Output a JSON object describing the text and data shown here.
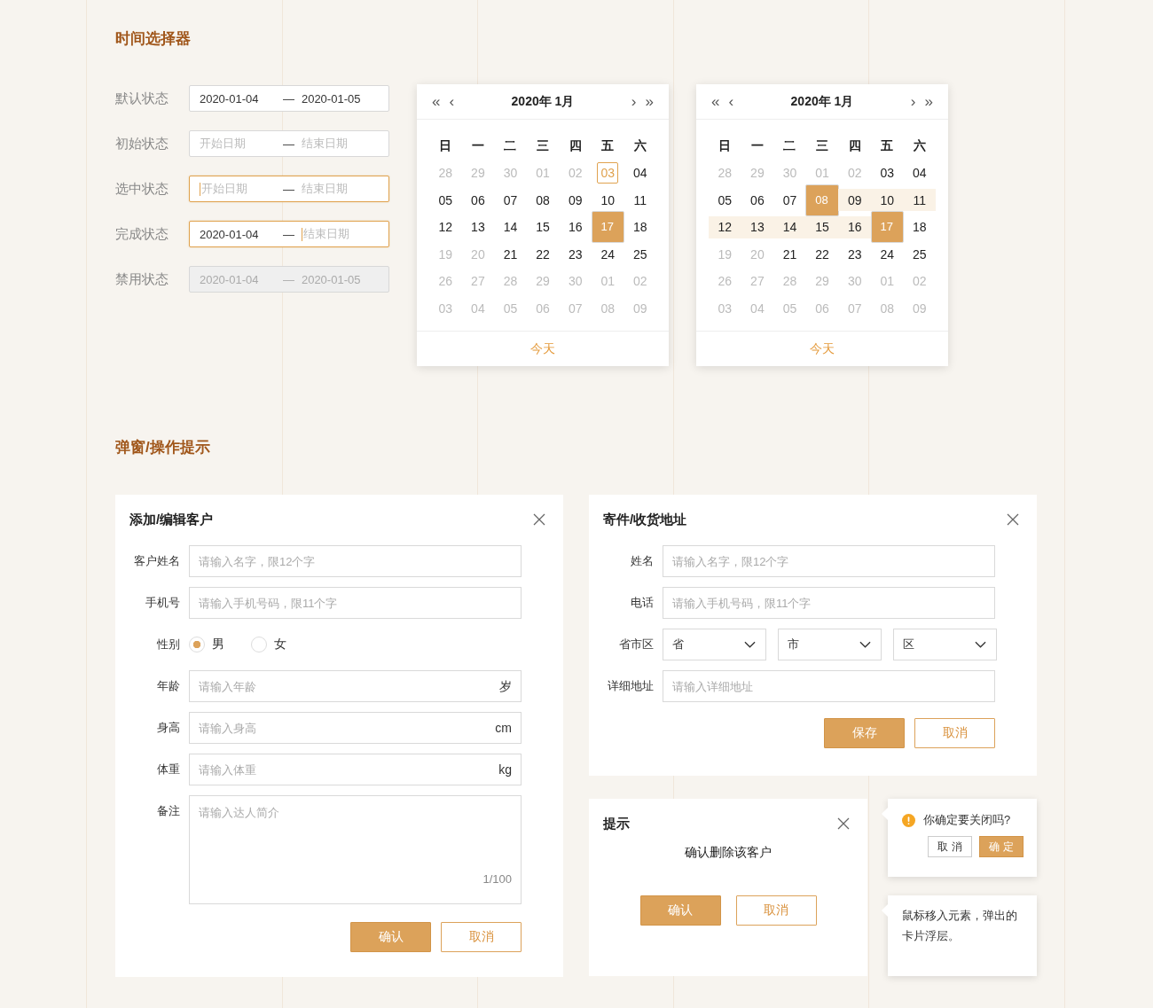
{
  "date_picker": {
    "title": "时间选择器",
    "rows": [
      {
        "label": "默认状态",
        "focused": false,
        "disabled": false,
        "separator": "—",
        "start": {
          "value": "2020-01-04",
          "cursor": false
        },
        "end": {
          "value": "2020-01-05",
          "cursor": false
        }
      },
      {
        "label": "初始状态",
        "focused": false,
        "disabled": false,
        "separator": "—",
        "start": {
          "placeholder": "开始日期",
          "cursor": false
        },
        "end": {
          "placeholder": "结束日期",
          "cursor": false
        }
      },
      {
        "label": "选中状态",
        "focused": true,
        "disabled": false,
        "separator": "—",
        "start": {
          "placeholder": "开始日期",
          "cursor": true
        },
        "end": {
          "placeholder": "结束日期",
          "cursor": false
        }
      },
      {
        "label": "完成状态",
        "focused": true,
        "disabled": false,
        "separator": "—",
        "start": {
          "value": "2020-01-04",
          "cursor": false
        },
        "end": {
          "placeholder": "结束日期",
          "cursor": true
        }
      },
      {
        "label": "禁用状态",
        "focused": false,
        "disabled": true,
        "separator": "—",
        "start": {
          "value": "2020-01-04",
          "cursor": false
        },
        "end": {
          "value": "2020-01-05",
          "cursor": false
        }
      }
    ],
    "calendars": [
      {
        "nav": [
          {
            "kind": "prev_year",
            "text": "«"
          },
          {
            "kind": "prev_month",
            "text": "‹"
          },
          {
            "kind": "title",
            "text": "2020年 1月"
          },
          {
            "kind": "next_month",
            "text": "›"
          },
          {
            "kind": "next_year",
            "text": "»"
          }
        ],
        "weekdays": [
          "日",
          "一",
          "二",
          "三",
          "四",
          "五",
          "六"
        ],
        "weeks": [
          [
            {
              "day": "28",
              "muted": true,
              "today": false,
              "selected": false,
              "in_range": false
            },
            {
              "day": "29",
              "muted": true,
              "today": false,
              "selected": false,
              "in_range": false
            },
            {
              "day": "30",
              "muted": true,
              "today": false,
              "selected": false,
              "in_range": false
            },
            {
              "day": "01",
              "muted": true,
              "today": false,
              "selected": false,
              "in_range": false
            },
            {
              "day": "02",
              "muted": true,
              "today": false,
              "selected": false,
              "in_range": false
            },
            {
              "day": "03",
              "muted": false,
              "today": true,
              "selected": false,
              "in_range": false
            },
            {
              "day": "04",
              "muted": false,
              "today": false,
              "selected": false,
              "in_range": false
            }
          ],
          [
            {
              "day": "05",
              "muted": false,
              "today": false,
              "selected": false,
              "in_range": false
            },
            {
              "day": "06",
              "muted": false,
              "today": false,
              "selected": false,
              "in_range": false
            },
            {
              "day": "07",
              "muted": false,
              "today": false,
              "selected": false,
              "in_range": false
            },
            {
              "day": "08",
              "muted": false,
              "today": false,
              "selected": false,
              "in_range": false
            },
            {
              "day": "09",
              "muted": false,
              "today": false,
              "selected": false,
              "in_range": false
            },
            {
              "day": "10",
              "muted": false,
              "today": false,
              "selected": false,
              "in_range": false
            },
            {
              "day": "11",
              "muted": false,
              "today": false,
              "selected": false,
              "in_range": false
            }
          ],
          [
            {
              "day": "12",
              "muted": false,
              "today": false,
              "selected": false,
              "in_range": false
            },
            {
              "day": "13",
              "muted": false,
              "today": false,
              "selected": false,
              "in_range": false
            },
            {
              "day": "14",
              "muted": false,
              "today": false,
              "selected": false,
              "in_range": false
            },
            {
              "day": "15",
              "muted": false,
              "today": false,
              "selected": false,
              "in_range": false
            },
            {
              "day": "16",
              "muted": false,
              "today": false,
              "selected": false,
              "in_range": false
            },
            {
              "day": "17",
              "muted": false,
              "today": false,
              "selected": true,
              "in_range": false
            },
            {
              "day": "18",
              "muted": false,
              "today": false,
              "selected": false,
              "in_range": false
            }
          ],
          [
            {
              "day": "19",
              "muted": true,
              "today": false,
              "selected": false,
              "in_range": false
            },
            {
              "day": "20",
              "muted": true,
              "today": false,
              "selected": false,
              "in_range": false
            },
            {
              "day": "21",
              "muted": false,
              "today": false,
              "selected": false,
              "in_range": false
            },
            {
              "day": "22",
              "muted": false,
              "today": false,
              "selected": false,
              "in_range": false
            },
            {
              "day": "23",
              "muted": false,
              "today": false,
              "selected": false,
              "in_range": false
            },
            {
              "day": "24",
              "muted": false,
              "today": false,
              "selected": false,
              "in_range": false
            },
            {
              "day": "25",
              "muted": false,
              "today": false,
              "selected": false,
              "in_range": false
            }
          ],
          [
            {
              "day": "26",
              "muted": true,
              "today": false,
              "selected": false,
              "in_range": false
            },
            {
              "day": "27",
              "muted": true,
              "today": false,
              "selected": false,
              "in_range": false
            },
            {
              "day": "28",
              "muted": true,
              "today": false,
              "selected": false,
              "in_range": false
            },
            {
              "day": "29",
              "muted": true,
              "today": false,
              "selected": false,
              "in_range": false
            },
            {
              "day": "30",
              "muted": true,
              "today": false,
              "selected": false,
              "in_range": false
            },
            {
              "day": "01",
              "muted": true,
              "today": false,
              "selected": false,
              "in_range": false
            },
            {
              "day": "02",
              "muted": true,
              "today": false,
              "selected": false,
              "in_range": false
            }
          ],
          [
            {
              "day": "03",
              "muted": true,
              "today": false,
              "selected": false,
              "in_range": false
            },
            {
              "day": "04",
              "muted": true,
              "today": false,
              "selected": false,
              "in_range": false
            },
            {
              "day": "05",
              "muted": true,
              "today": false,
              "selected": false,
              "in_range": false
            },
            {
              "day": "06",
              "muted": true,
              "today": false,
              "selected": false,
              "in_range": false
            },
            {
              "day": "07",
              "muted": true,
              "today": false,
              "selected": false,
              "in_range": false
            },
            {
              "day": "08",
              "muted": true,
              "today": false,
              "selected": false,
              "in_range": false
            },
            {
              "day": "09",
              "muted": true,
              "today": false,
              "selected": false,
              "in_range": false
            }
          ]
        ],
        "footer": "今天"
      },
      {
        "nav": [
          {
            "kind": "prev_year",
            "text": "«"
          },
          {
            "kind": "prev_month",
            "text": "‹"
          },
          {
            "kind": "title",
            "text": "2020年 1月"
          },
          {
            "kind": "next_month",
            "text": "›"
          },
          {
            "kind": "next_year",
            "text": "»"
          }
        ],
        "weekdays": [
          "日",
          "一",
          "二",
          "三",
          "四",
          "五",
          "六"
        ],
        "weeks": [
          [
            {
              "day": "28",
              "muted": true,
              "today": false,
              "selected": false,
              "in_range": false
            },
            {
              "day": "29",
              "muted": true,
              "today": false,
              "selected": false,
              "in_range": false
            },
            {
              "day": "30",
              "muted": true,
              "today": false,
              "selected": false,
              "in_range": false
            },
            {
              "day": "01",
              "muted": true,
              "today": false,
              "selected": false,
              "in_range": false
            },
            {
              "day": "02",
              "muted": true,
              "today": false,
              "selected": false,
              "in_range": false
            },
            {
              "day": "03",
              "muted": false,
              "today": false,
              "selected": false,
              "in_range": false
            },
            {
              "day": "04",
              "muted": false,
              "today": false,
              "selected": false,
              "in_range": false
            }
          ],
          [
            {
              "day": "05",
              "muted": false,
              "today": false,
              "selected": false,
              "in_range": false
            },
            {
              "day": "06",
              "muted": false,
              "today": false,
              "selected": false,
              "in_range": false
            },
            {
              "day": "07",
              "muted": false,
              "today": false,
              "selected": false,
              "in_range": false
            },
            {
              "day": "08",
              "muted": false,
              "today": false,
              "selected": true,
              "in_range": true
            },
            {
              "day": "09",
              "muted": false,
              "today": false,
              "selected": false,
              "in_range": true
            },
            {
              "day": "10",
              "muted": false,
              "today": false,
              "selected": false,
              "in_range": true
            },
            {
              "day": "11",
              "muted": false,
              "today": false,
              "selected": false,
              "in_range": true
            }
          ],
          [
            {
              "day": "12",
              "muted": false,
              "today": false,
              "selected": false,
              "in_range": true
            },
            {
              "day": "13",
              "muted": false,
              "today": false,
              "selected": false,
              "in_range": true
            },
            {
              "day": "14",
              "muted": false,
              "today": false,
              "selected": false,
              "in_range": true
            },
            {
              "day": "15",
              "muted": false,
              "today": false,
              "selected": false,
              "in_range": true
            },
            {
              "day": "16",
              "muted": false,
              "today": false,
              "selected": false,
              "in_range": true
            },
            {
              "day": "17",
              "muted": false,
              "today": false,
              "selected": true,
              "in_range": true
            },
            {
              "day": "18",
              "muted": false,
              "today": false,
              "selected": false,
              "in_range": false
            }
          ],
          [
            {
              "day": "19",
              "muted": true,
              "today": false,
              "selected": false,
              "in_range": false
            },
            {
              "day": "20",
              "muted": true,
              "today": false,
              "selected": false,
              "in_range": false
            },
            {
              "day": "21",
              "muted": false,
              "today": false,
              "selected": false,
              "in_range": false
            },
            {
              "day": "22",
              "muted": false,
              "today": false,
              "selected": false,
              "in_range": false
            },
            {
              "day": "23",
              "muted": false,
              "today": false,
              "selected": false,
              "in_range": false
            },
            {
              "day": "24",
              "muted": false,
              "today": false,
              "selected": false,
              "in_range": false
            },
            {
              "day": "25",
              "muted": false,
              "today": false,
              "selected": false,
              "in_range": false
            }
          ],
          [
            {
              "day": "26",
              "muted": true,
              "today": false,
              "selected": false,
              "in_range": false
            },
            {
              "day": "27",
              "muted": true,
              "today": false,
              "selected": false,
              "in_range": false
            },
            {
              "day": "28",
              "muted": true,
              "today": false,
              "selected": false,
              "in_range": false
            },
            {
              "day": "29",
              "muted": true,
              "today": false,
              "selected": false,
              "in_range": false
            },
            {
              "day": "30",
              "muted": true,
              "today": false,
              "selected": false,
              "in_range": false
            },
            {
              "day": "01",
              "muted": true,
              "today": false,
              "selected": false,
              "in_range": false
            },
            {
              "day": "02",
              "muted": true,
              "today": false,
              "selected": false,
              "in_range": false
            }
          ],
          [
            {
              "day": "03",
              "muted": true,
              "today": false,
              "selected": false,
              "in_range": false
            },
            {
              "day": "04",
              "muted": true,
              "today": false,
              "selected": false,
              "in_range": false
            },
            {
              "day": "05",
              "muted": true,
              "today": false,
              "selected": false,
              "in_range": false
            },
            {
              "day": "06",
              "muted": true,
              "today": false,
              "selected": false,
              "in_range": false
            },
            {
              "day": "07",
              "muted": true,
              "today": false,
              "selected": false,
              "in_range": false
            },
            {
              "day": "08",
              "muted": true,
              "today": false,
              "selected": false,
              "in_range": false
            },
            {
              "day": "09",
              "muted": true,
              "today": false,
              "selected": false,
              "in_range": false
            }
          ]
        ],
        "footer": "今天"
      }
    ]
  },
  "dialogs_section": {
    "title": "弹窗/操作提示",
    "customer_dialog": {
      "title": "添加/编辑客户",
      "fields": [
        {
          "kind": "text",
          "label": "客户姓名",
          "placeholder": "请输入名字，限12个字"
        },
        {
          "kind": "text",
          "label": "手机号",
          "placeholder": "请输入手机号码，限11个字"
        },
        {
          "kind": "radio",
          "label": "性别",
          "options": [
            {
              "label": "男",
              "selected": true
            },
            {
              "label": "女",
              "selected": false
            }
          ]
        },
        {
          "kind": "text",
          "label": "年龄",
          "placeholder": "请输入年龄",
          "suffix": "岁"
        },
        {
          "kind": "text",
          "label": "身高",
          "placeholder": "请输入身高",
          "suffix": "cm"
        },
        {
          "kind": "text",
          "label": "体重",
          "placeholder": "请输入体重",
          "suffix": "kg"
        },
        {
          "kind": "textarea",
          "label": "备注",
          "placeholder": "请输入达人简介",
          "counter": "1/100"
        }
      ],
      "buttons": [
        {
          "label": "确认",
          "kind": "primary"
        },
        {
          "label": "取消",
          "kind": "secondary"
        }
      ]
    },
    "address_dialog": {
      "title": "寄件/收货地址",
      "fields": [
        {
          "kind": "text",
          "label": "姓名",
          "placeholder": "请输入名字，限12个字"
        },
        {
          "kind": "text",
          "label": "电话",
          "placeholder": "请输入手机号码，限11个字"
        },
        {
          "kind": "selects",
          "label": "省市区",
          "options": [
            {
              "value": "省"
            },
            {
              "value": "市"
            },
            {
              "value": "区"
            }
          ]
        },
        {
          "kind": "text",
          "label": "详细地址",
          "placeholder": "请输入详细地址"
        }
      ],
      "buttons": [
        {
          "label": "保存",
          "kind": "primary"
        },
        {
          "label": "取消",
          "kind": "secondary"
        }
      ]
    },
    "confirm_dialog": {
      "title": "提示",
      "message": "确认删除该客户",
      "buttons": [
        {
          "label": "确认",
          "kind": "primary"
        },
        {
          "label": "取消",
          "kind": "secondary"
        }
      ]
    },
    "popconfirm": {
      "message": "你确定要关闭吗?",
      "buttons": [
        {
          "label": "取 消",
          "kind": "secondary"
        },
        {
          "label": "确 定",
          "kind": "primary"
        }
      ]
    },
    "hover_card": {
      "text": "鼠标移入元素，弹出的卡片浮层。"
    }
  }
}
